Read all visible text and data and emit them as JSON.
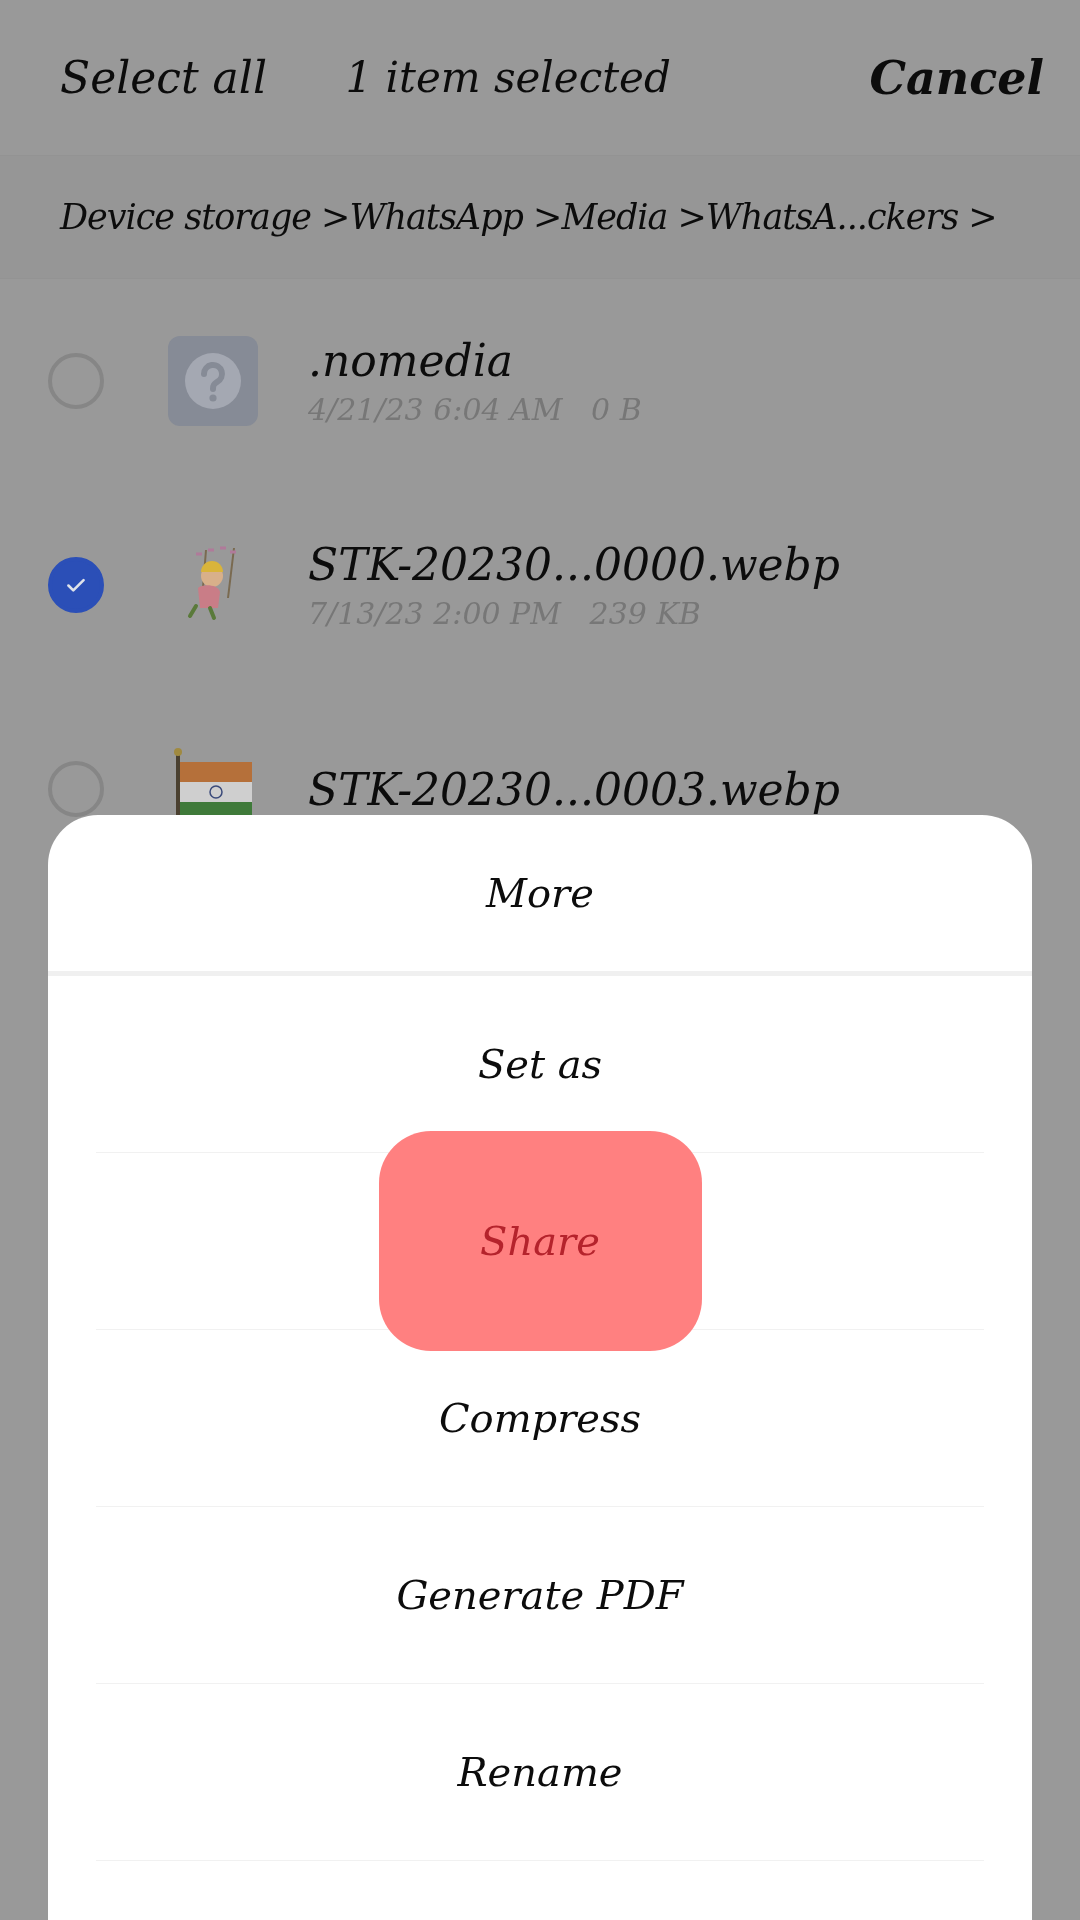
{
  "top_bar": {
    "select_all": "Select all",
    "title": "1 item selected",
    "cancel": "Cancel"
  },
  "breadcrumb": "Device storage >WhatsApp >Media >WhatsA...ckers >",
  "files": [
    {
      "kind": "unknown",
      "name": ".nomedia",
      "meta": "4/21/23 6:04 AM   0 B",
      "selected": false
    },
    {
      "kind": "sticker",
      "name": "STK-20230...0000.webp",
      "meta": "7/13/23 2:00 PM   239 KB",
      "selected": true
    },
    {
      "kind": "flag",
      "name": "STK-20230...0003.webp",
      "selected": false
    }
  ],
  "sheet": {
    "title": "More",
    "items": [
      {
        "label": "Set as",
        "highlighted": false
      },
      {
        "label": "Share",
        "highlighted": true
      },
      {
        "label": "Compress",
        "highlighted": false
      },
      {
        "label": "Generate PDF",
        "highlighted": false
      },
      {
        "label": "Rename",
        "highlighted": false
      }
    ]
  }
}
